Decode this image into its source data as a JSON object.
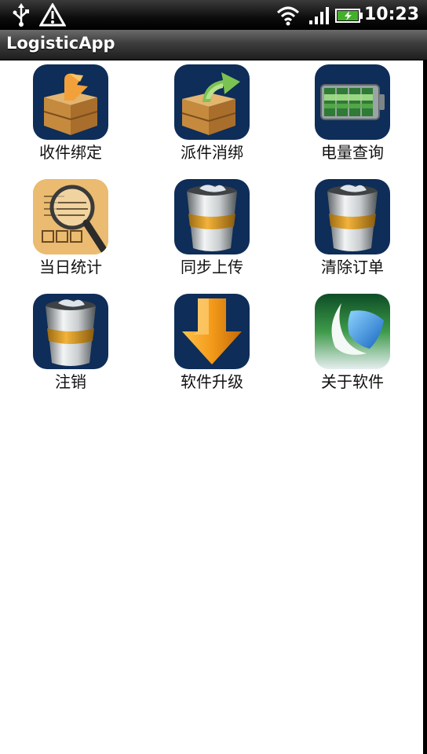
{
  "status_bar": {
    "time": "10:23",
    "left_icons": [
      "usb-icon",
      "warning-icon"
    ],
    "right_icons": [
      "wifi-icon",
      "signal-icon",
      "battery-icon"
    ]
  },
  "app": {
    "title": "LogisticApp"
  },
  "menu": {
    "items": [
      {
        "label": "收件绑定",
        "icon": "box-receive-icon"
      },
      {
        "label": "派件消绑",
        "icon": "box-send-icon"
      },
      {
        "label": "电量查询",
        "icon": "battery-query-icon"
      },
      {
        "label": "当日统计",
        "icon": "magnifier-statistics-icon"
      },
      {
        "label": "同步上传",
        "icon": "trash-can-icon"
      },
      {
        "label": "清除订单",
        "icon": "trash-can-icon"
      },
      {
        "label": "注销",
        "icon": "trash-can-icon"
      },
      {
        "label": "软件升级",
        "icon": "download-arrow-icon"
      },
      {
        "label": "关于软件",
        "icon": "app-logo-icon"
      }
    ]
  },
  "colors": {
    "icon_bg": "#0e2d58",
    "titlebar": "#3d3d3d",
    "statusbar": "#000000"
  }
}
